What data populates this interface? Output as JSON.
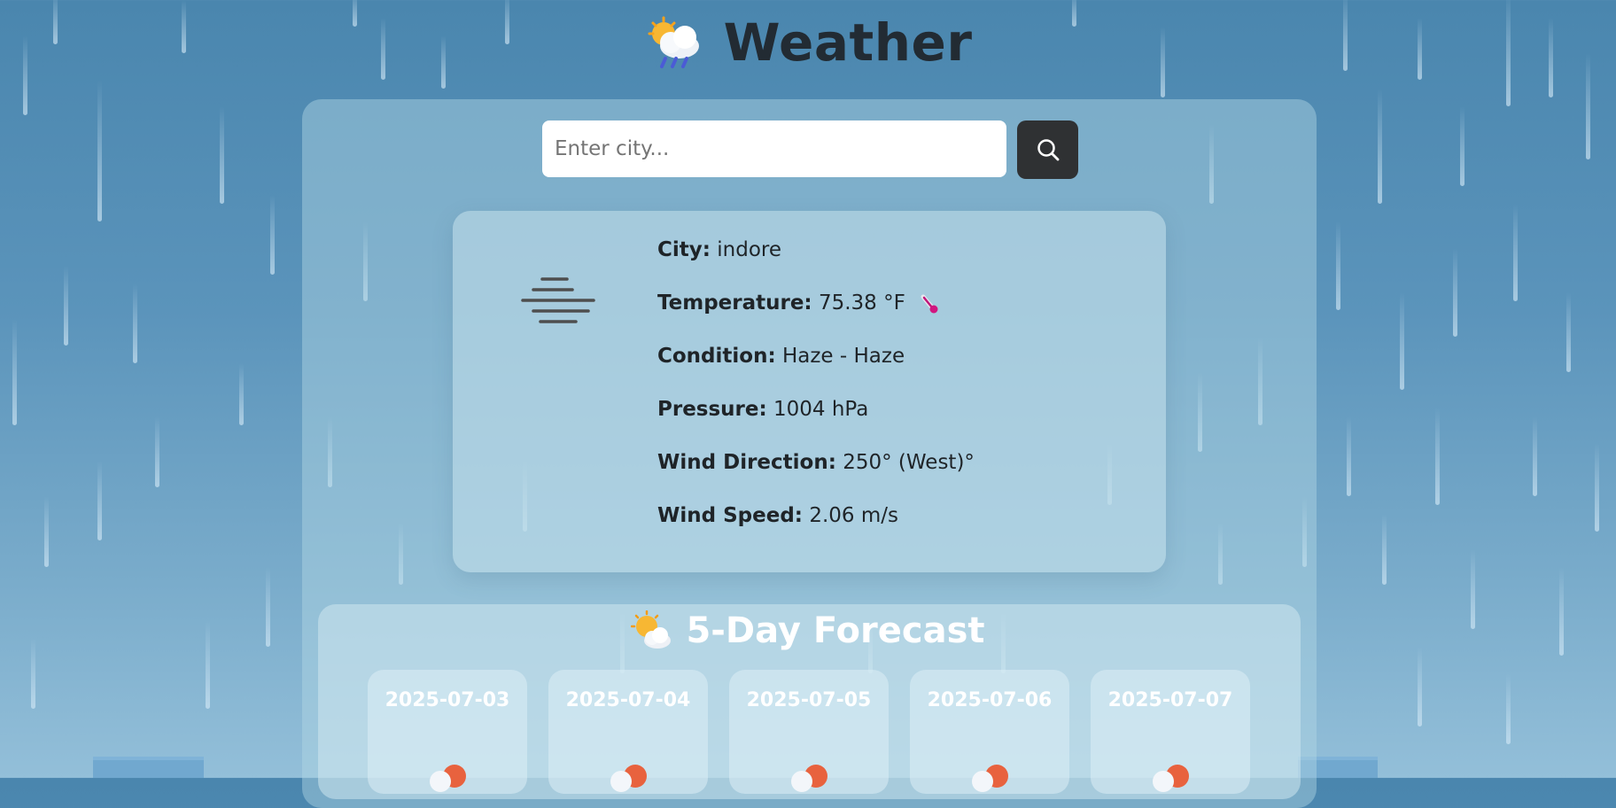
{
  "header": {
    "title": "Weather",
    "icon": "sun-behind-rain-cloud-icon"
  },
  "search": {
    "placeholder": "Enter city...",
    "value": "",
    "button_icon": "search-icon"
  },
  "current": {
    "icon": "haze-icon",
    "city_label": "City:",
    "city": "indore",
    "temperature_label": "Temperature:",
    "temperature": "75.38 °F",
    "temperature_icon": "thermometer-icon",
    "condition_label": "Condition:",
    "condition": "Haze - Haze",
    "pressure_label": "Pressure:",
    "pressure": "1004 hPa",
    "wind_direction_label": "Wind Direction:",
    "wind_direction": "250° (West)°",
    "wind_speed_label": "Wind Speed:",
    "wind_speed": "2.06 m/s"
  },
  "forecast": {
    "title": "5-Day Forecast",
    "icon": "sun-behind-cloud-icon",
    "days": [
      {
        "date": "2025-07-03"
      },
      {
        "date": "2025-07-04"
      },
      {
        "date": "2025-07-05"
      },
      {
        "date": "2025-07-06"
      },
      {
        "date": "2025-07-07"
      }
    ]
  },
  "colors": {
    "background": "#4a86ae",
    "title_text": "#222b33",
    "search_button": "#2f3133",
    "forecast_title": "#ffffff"
  }
}
